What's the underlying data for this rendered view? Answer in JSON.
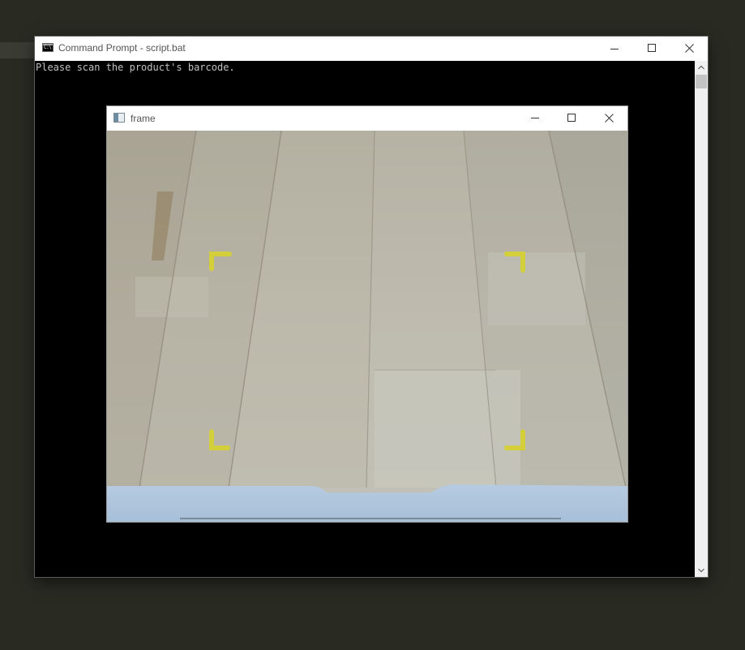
{
  "cmd_window": {
    "title": "Command Prompt - script.bat",
    "icon_glyph": "C:\\",
    "console_text": "Please scan the product's barcode."
  },
  "frame_window": {
    "title": "frame",
    "scan_corner_color": "#d3cf3a"
  },
  "icons": {
    "minimize": "minimize-icon",
    "maximize": "maximize-icon",
    "close": "close-icon",
    "scroll_up": "chevron-up-icon",
    "scroll_down": "chevron-down-icon"
  }
}
